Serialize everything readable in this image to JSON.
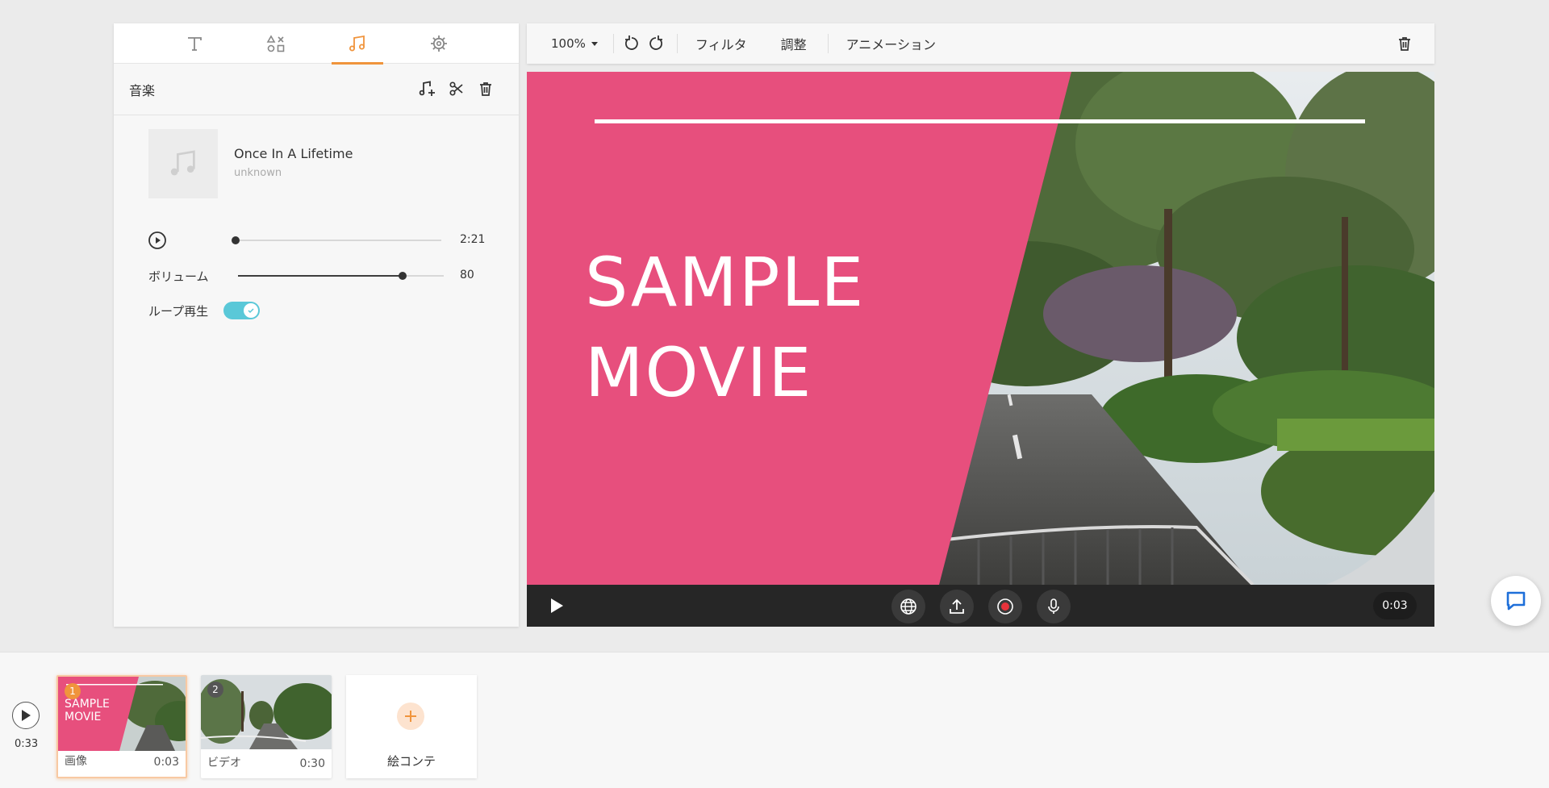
{
  "left_panel": {
    "tabs": [
      {
        "icon": "text-icon"
      },
      {
        "icon": "shapes-icon"
      },
      {
        "icon": "music-icon",
        "active": true
      },
      {
        "icon": "settings-icon"
      }
    ],
    "title": "音楽",
    "track": {
      "title": "Once In A Lifetime",
      "artist": "unknown",
      "duration": "2:21",
      "playhead_fraction": 0.0
    },
    "volume": {
      "label": "ボリューム",
      "value": "80",
      "fraction": 0.8
    },
    "loop": {
      "label": "ループ再生",
      "on": true
    }
  },
  "toolbar": {
    "zoom": "100%",
    "filter": "フィルタ",
    "adjust": "調整",
    "animation": "アニメーション"
  },
  "canvas": {
    "headline": "SAMPLE\nMOVIE",
    "accent_color": "#e74f7d"
  },
  "player": {
    "time": "0:03"
  },
  "timeline": {
    "total": "0:33",
    "clips": [
      {
        "num": "1",
        "label": "画像",
        "duration": "0:03",
        "thumb_text": "SAMPLE\nMOVIE",
        "selected": true
      },
      {
        "num": "2",
        "label": "ビデオ",
        "duration": "0:30",
        "selected": false
      }
    ],
    "add_label": "絵コンテ"
  },
  "colors": {
    "accent": "#f0943c",
    "toggle": "#5ac8d8",
    "pink": "#e74f7d"
  }
}
